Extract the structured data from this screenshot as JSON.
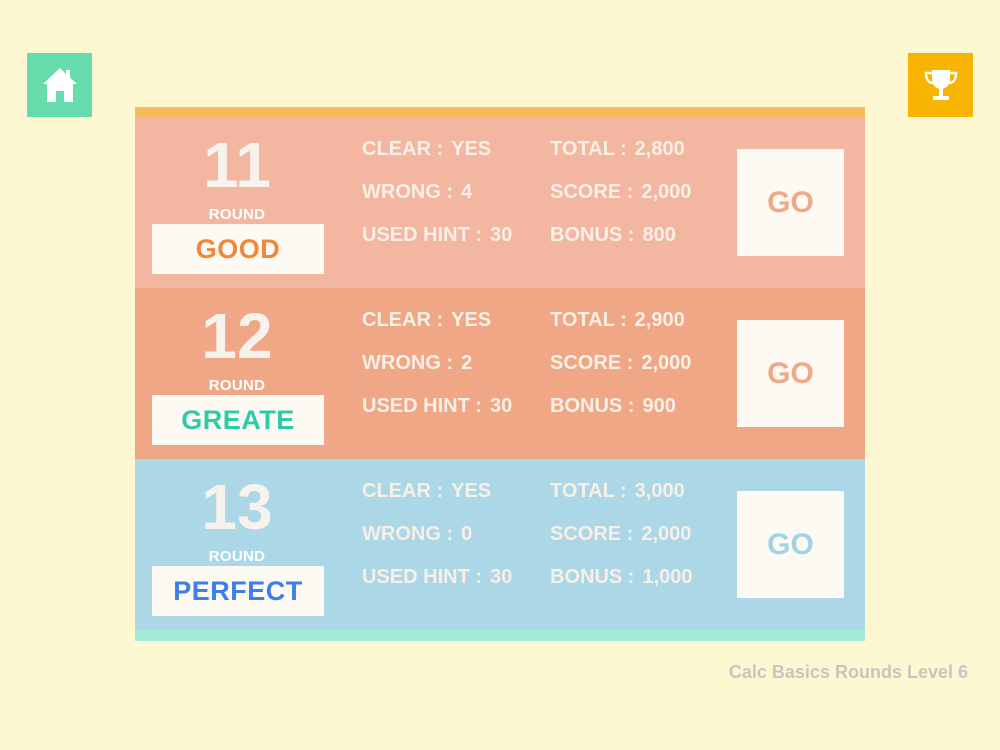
{
  "colors": {
    "background": "#fdf8d2",
    "home": "#66dbac",
    "trophy": "#f6b500",
    "row_bg": [
      "#f2b6a1",
      "#efa785",
      "#acd7e6"
    ],
    "grade_text": [
      "#f0873a",
      "#2fcaa8",
      "#3e7ee8"
    ],
    "go_text": [
      "#f0a78a",
      "#f0a78a",
      "#9fd4e6"
    ]
  },
  "header": {
    "home_icon": "home-icon",
    "trophy_icon": "trophy-icon"
  },
  "rounds": [
    {
      "number": "11",
      "round_label": "ROUND",
      "grade": "GOOD",
      "clear_label": "CLEAR :",
      "clear_value": "YES",
      "wrong_label": "WRONG :",
      "wrong_value": "4",
      "hint_label": "USED HINT :",
      "hint_value": "30",
      "total_label": "TOTAL :",
      "total_value": "2,800",
      "score_label": "SCORE :",
      "score_value": "2,000",
      "bonus_label": "BONUS :",
      "bonus_value": "800",
      "go_label": "GO"
    },
    {
      "number": "12",
      "round_label": "ROUND",
      "grade": "GREATE",
      "clear_label": "CLEAR :",
      "clear_value": "YES",
      "wrong_label": "WRONG :",
      "wrong_value": "2",
      "hint_label": "USED HINT :",
      "hint_value": "30",
      "total_label": "TOTAL :",
      "total_value": "2,900",
      "score_label": "SCORE :",
      "score_value": "2,000",
      "bonus_label": "BONUS :",
      "bonus_value": "900",
      "go_label": "GO"
    },
    {
      "number": "13",
      "round_label": "ROUND",
      "grade": "PERFECT",
      "clear_label": "CLEAR :",
      "clear_value": "YES",
      "wrong_label": "WRONG :",
      "wrong_value": "0",
      "hint_label": "USED HINT :",
      "hint_value": "30",
      "total_label": "TOTAL :",
      "total_value": "3,000",
      "score_label": "SCORE :",
      "score_value": "2,000",
      "bonus_label": "BONUS :",
      "bonus_value": "1,000",
      "go_label": "GO"
    }
  ],
  "footer": {
    "text": "Calc Basics Rounds Level 6"
  }
}
